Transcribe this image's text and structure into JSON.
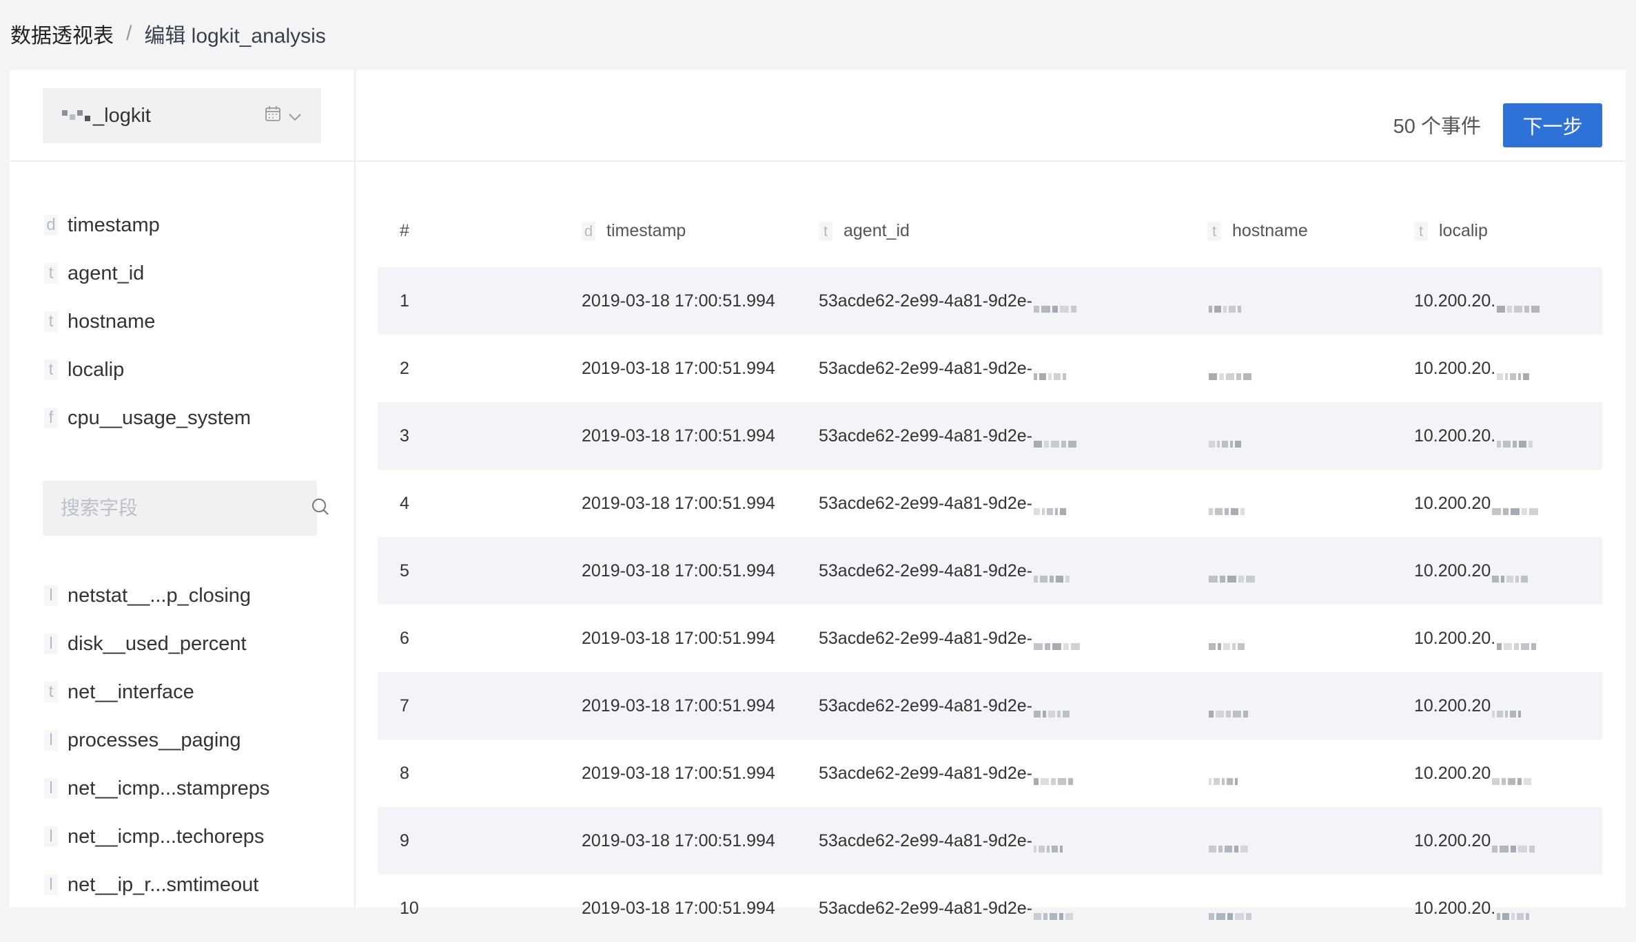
{
  "breadcrumb": {
    "root": "数据透视表",
    "separator": "/",
    "current": "编辑 logkit_analysis"
  },
  "repo_select": {
    "value": "_logkit"
  },
  "fields_primary": [
    {
      "type": "d",
      "name": "timestamp"
    },
    {
      "type": "t",
      "name": "agent_id"
    },
    {
      "type": "t",
      "name": "hostname"
    },
    {
      "type": "t",
      "name": "localip"
    },
    {
      "type": "f",
      "name": "cpu__usage_system"
    }
  ],
  "search": {
    "placeholder": "搜索字段"
  },
  "fields_secondary": [
    {
      "type": "l",
      "name": "netstat__...p_closing"
    },
    {
      "type": "l",
      "name": "disk__used_percent"
    },
    {
      "type": "t",
      "name": "net__interface"
    },
    {
      "type": "l",
      "name": "processes__paging"
    },
    {
      "type": "l",
      "name": "net__icmp...stampreps"
    },
    {
      "type": "l",
      "name": "net__icmp...techoreps"
    },
    {
      "type": "l",
      "name": "net__ip_r...smtimeout"
    }
  ],
  "toolbar": {
    "event_count": "50 个事件",
    "next_label": "下一步"
  },
  "table": {
    "columns": [
      {
        "type": "",
        "label": "#"
      },
      {
        "type": "d",
        "label": "timestamp"
      },
      {
        "type": "t",
        "label": "agent_id"
      },
      {
        "type": "t",
        "label": "hostname"
      },
      {
        "type": "t",
        "label": "localip"
      }
    ],
    "rows": [
      {
        "idx": "1",
        "timestamp": "2019-03-18 17:00:51.994",
        "agent_id": "53acde62-2e99-4a81-9d2e-",
        "hostname": "",
        "localip": "10.200.20."
      },
      {
        "idx": "2",
        "timestamp": "2019-03-18 17:00:51.994",
        "agent_id": "53acde62-2e99-4a81-9d2e-",
        "hostname": "",
        "localip": "10.200.20."
      },
      {
        "idx": "3",
        "timestamp": "2019-03-18 17:00:51.994",
        "agent_id": "53acde62-2e99-4a81-9d2e-",
        "hostname": "",
        "localip": "10.200.20."
      },
      {
        "idx": "4",
        "timestamp": "2019-03-18 17:00:51.994",
        "agent_id": "53acde62-2e99-4a81-9d2e-",
        "hostname": "",
        "localip": "10.200.20"
      },
      {
        "idx": "5",
        "timestamp": "2019-03-18 17:00:51.994",
        "agent_id": "53acde62-2e99-4a81-9d2e-",
        "hostname": "",
        "localip": "10.200.20"
      },
      {
        "idx": "6",
        "timestamp": "2019-03-18 17:00:51.994",
        "agent_id": "53acde62-2e99-4a81-9d2e-",
        "hostname": "",
        "localip": "10.200.20."
      },
      {
        "idx": "7",
        "timestamp": "2019-03-18 17:00:51.994",
        "agent_id": "53acde62-2e99-4a81-9d2e-",
        "hostname": "",
        "localip": "10.200.20"
      },
      {
        "idx": "8",
        "timestamp": "2019-03-18 17:00:51.994",
        "agent_id": "53acde62-2e99-4a81-9d2e-",
        "hostname": "",
        "localip": "10.200.20"
      },
      {
        "idx": "9",
        "timestamp": "2019-03-18 17:00:51.994",
        "agent_id": "53acde62-2e99-4a81-9d2e-",
        "hostname": "",
        "localip": "10.200.20"
      },
      {
        "idx": "10",
        "timestamp": "2019-03-18 17:00:51.994",
        "agent_id": "53acde62-2e99-4a81-9d2e-",
        "hostname": "",
        "localip": "10.200.20."
      }
    ]
  },
  "colors": {
    "primary": "#2e72d8",
    "row_alt": "#f2f4f8",
    "page_bg": "#f3f4f6"
  },
  "icons": {
    "calendar": "calendar-icon",
    "dropdown": "chevron-down-icon",
    "search": "search-icon"
  }
}
